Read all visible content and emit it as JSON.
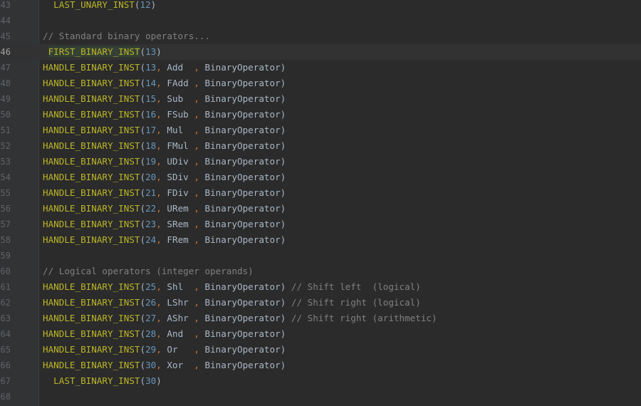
{
  "editor": {
    "lines": [
      {
        "num": "43",
        "text": "  LAST_UNARY_INST(12)"
      },
      {
        "num": "44",
        "text": ""
      },
      {
        "num": "45",
        "text": "// Standard binary operators..."
      },
      {
        "num": "46",
        "text": " FIRST_BINARY_INST(13)"
      },
      {
        "num": "47",
        "text": "HANDLE_BINARY_INST(13, Add  , BinaryOperator)"
      },
      {
        "num": "48",
        "text": "HANDLE_BINARY_INST(14, FAdd , BinaryOperator)"
      },
      {
        "num": "49",
        "text": "HANDLE_BINARY_INST(15, Sub  , BinaryOperator)"
      },
      {
        "num": "50",
        "text": "HANDLE_BINARY_INST(16, FSub , BinaryOperator)"
      },
      {
        "num": "51",
        "text": "HANDLE_BINARY_INST(17, Mul  , BinaryOperator)"
      },
      {
        "num": "52",
        "text": "HANDLE_BINARY_INST(18, FMul , BinaryOperator)"
      },
      {
        "num": "53",
        "text": "HANDLE_BINARY_INST(19, UDiv , BinaryOperator)"
      },
      {
        "num": "54",
        "text": "HANDLE_BINARY_INST(20, SDiv , BinaryOperator)"
      },
      {
        "num": "55",
        "text": "HANDLE_BINARY_INST(21, FDiv , BinaryOperator)"
      },
      {
        "num": "56",
        "text": "HANDLE_BINARY_INST(22, URem , BinaryOperator)"
      },
      {
        "num": "57",
        "text": "HANDLE_BINARY_INST(23, SRem , BinaryOperator)"
      },
      {
        "num": "58",
        "text": "HANDLE_BINARY_INST(24, FRem , BinaryOperator)"
      },
      {
        "num": "59",
        "text": ""
      },
      {
        "num": "60",
        "text": "// Logical operators (integer operands)"
      },
      {
        "num": "61",
        "text": "HANDLE_BINARY_INST(25, Shl  , BinaryOperator) // Shift left  (logical)"
      },
      {
        "num": "62",
        "text": "HANDLE_BINARY_INST(26, LShr , BinaryOperator) // Shift right (logical)"
      },
      {
        "num": "63",
        "text": "HANDLE_BINARY_INST(27, AShr , BinaryOperator) // Shift right (arithmetic)"
      },
      {
        "num": "64",
        "text": "HANDLE_BINARY_INST(28, And  , BinaryOperator)"
      },
      {
        "num": "65",
        "text": "HANDLE_BINARY_INST(29, Or   , BinaryOperator)"
      },
      {
        "num": "66",
        "text": "HANDLE_BINARY_INST(30, Xor  , BinaryOperator)"
      },
      {
        "num": "67",
        "text": "  LAST_BINARY_INST(30)"
      },
      {
        "num": "68",
        "text": ""
      }
    ]
  }
}
